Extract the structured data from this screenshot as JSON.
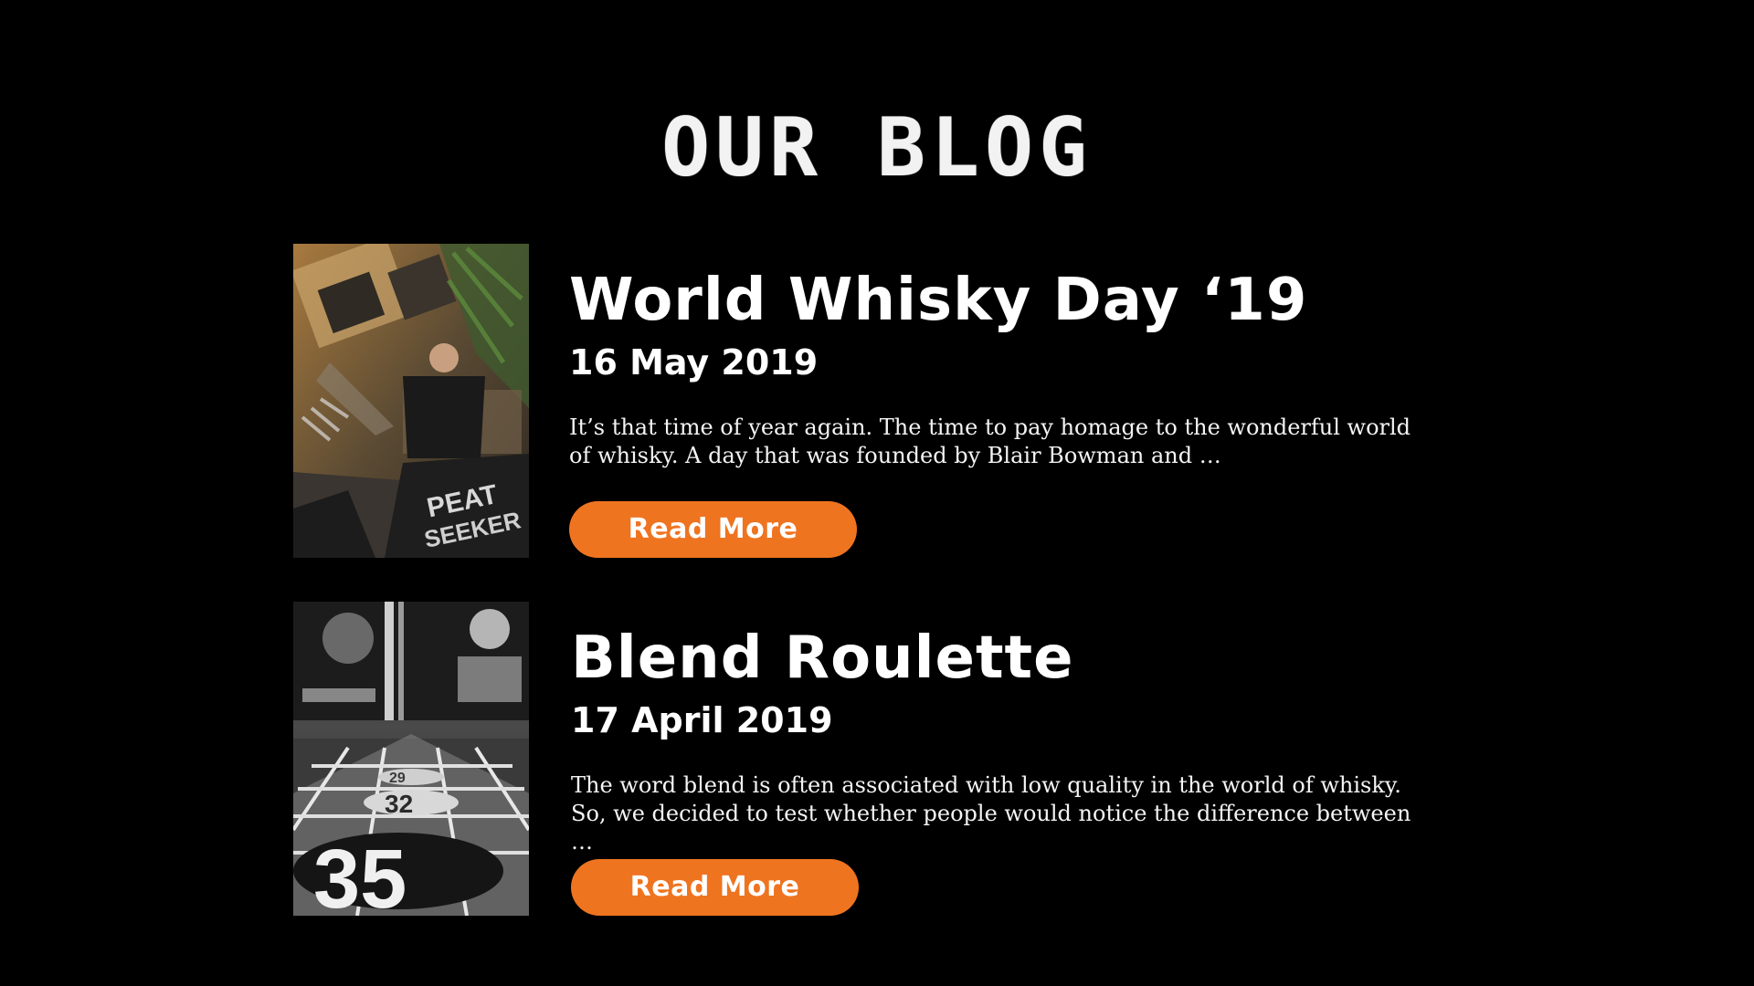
{
  "page": {
    "title": "OUR BLOG"
  },
  "posts": [
    {
      "title": "World Whisky Day ‘19",
      "date": "16 May 2019",
      "excerpt": "It’s that time of year again. The time to pay homage to the wonderful world of whisky. A day that was founded by Blair Bowman and …",
      "button_label": "Read More",
      "image_text": "PEAT SEEKER"
    },
    {
      "title": "Blend Roulette",
      "date": "17 April 2019",
      "excerpt": "The word blend is often associated with low quality in the world of whisky. So, we decided to test whether people would notice the difference between …",
      "button_label": "Read More",
      "image_numbers": [
        "35",
        "32",
        "29"
      ]
    }
  ],
  "colors": {
    "background": "#000000",
    "accent": "#ef7420",
    "text": "#ffffff"
  }
}
